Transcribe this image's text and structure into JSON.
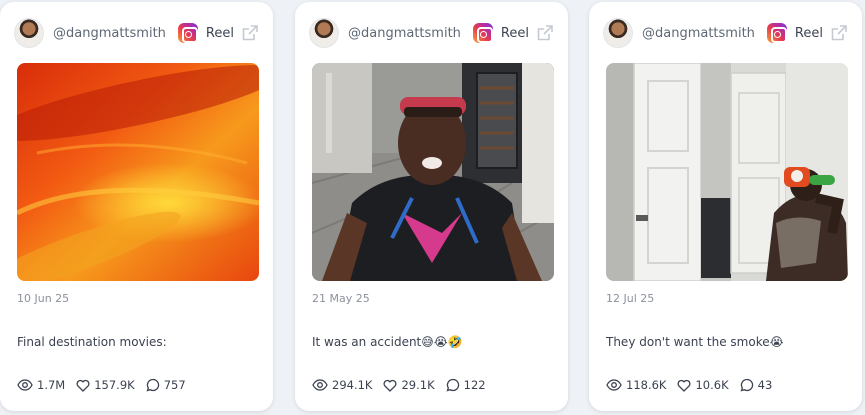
{
  "posts": [
    {
      "handle": "@dangmattsmith",
      "type_label": "Reel",
      "date": "10 Jun 25",
      "caption": "Final destination movies:",
      "views": "1.7M",
      "likes": "157.9K",
      "comments": "757",
      "thumbnail": "orange-fire-blur"
    },
    {
      "handle": "@dangmattsmith",
      "type_label": "Reel",
      "date": "21 May 25",
      "caption": "It was an accident😅😭🤣",
      "views": "294.1K",
      "likes": "29.1K",
      "comments": "122",
      "thumbnail": "man-in-kitchen"
    },
    {
      "handle": "@dangmattsmith",
      "type_label": "Reel",
      "date": "12 Jul 25",
      "caption": "They don't want the smoke😭",
      "views": "118.6K",
      "likes": "10.6K",
      "comments": "43",
      "thumbnail": "door-and-water-gun"
    }
  ],
  "icons": {
    "platform": "instagram-icon",
    "external": "external-link-icon",
    "views": "eye-icon",
    "likes": "heart-icon",
    "comments": "comment-icon"
  },
  "colors": {
    "page_bg": "#eef1f5",
    "card_bg": "#ffffff",
    "muted_text": "#8a929e",
    "icon_gray": "#c5cad2"
  }
}
